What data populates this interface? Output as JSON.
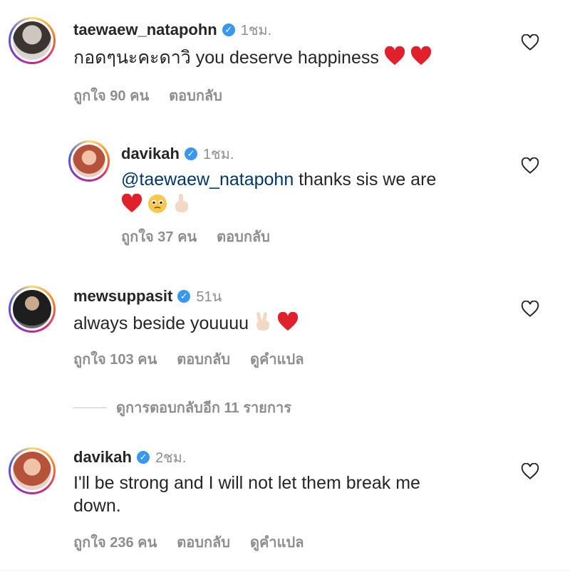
{
  "comments": [
    {
      "username": "taewaew_natapohn",
      "time": "1ชม.",
      "text": "กอดๆนะคะดาวิ you deserve happiness",
      "likes": "ถูกใจ 90 คน",
      "reply": "ตอบกลับ"
    },
    {
      "username": "davikah",
      "time": "1ชม.",
      "mention": "@taewaew_natapohn",
      "text": " thanks sis we are",
      "likes": "ถูกใจ 37 คน",
      "reply": "ตอบกลับ"
    },
    {
      "username": "mewsuppasit",
      "time": "51น",
      "text": "always beside youuuu",
      "likes": "ถูกใจ 103 คน",
      "reply": "ตอบกลับ",
      "translate": "ดูคำแปล"
    },
    {
      "username": "davikah",
      "time": "2ชม.",
      "text_line1": "I'll be strong and I will not let them break me",
      "text_line2": "down.",
      "likes": "ถูกใจ 236 คน",
      "reply": "ตอบกลับ",
      "translate": "ดูคำแปล"
    }
  ],
  "view_more_replies": "ดูการตอบกลับอีก 11 รายการ",
  "icons": {
    "verified": "verified-badge-icon",
    "like": "heart-outline-icon"
  },
  "colors": {
    "verified": "#3897f0",
    "mention": "#00376b",
    "heart_emoji": "#e0202b",
    "secondary_text": "#8e8e8e"
  }
}
